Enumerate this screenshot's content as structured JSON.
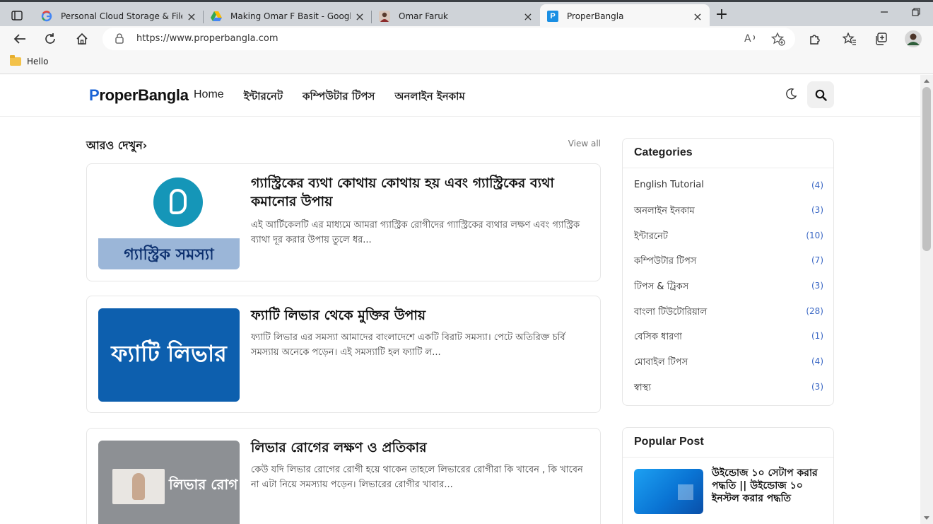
{
  "browser": {
    "tabs": [
      {
        "title": "Personal Cloud Storage & File Sh",
        "favicon": "google-icon"
      },
      {
        "title": "Making Omar F Basit - Google D",
        "favicon": "google-drive-icon"
      },
      {
        "title": "Omar Faruk",
        "favicon": "profile-photo-icon"
      },
      {
        "title": "ProperBangla",
        "favicon": "properbangla-p-icon",
        "favicon_letter": "P"
      }
    ],
    "url": "https://www.properbangla.com",
    "bookmark": "Hello"
  },
  "site": {
    "logo_first": "P",
    "logo_rest": "roperBangla",
    "nav": [
      "Home",
      "ইন্টারনেট",
      "কম্পিউটার টিপস",
      "অনলাইন ইনকাম"
    ]
  },
  "main": {
    "section_title": "আরও দেখুন",
    "view_all": "View all",
    "posts": [
      {
        "title": "গ্যাস্ট্রিকের ব্যথা কোথায় কোথায় হয় এবং গ্যাস্ট্রিকের ব্যথা কমানোর উপায়",
        "excerpt": "এই আর্টিকেলটি এর মাধ্যমে আমরা গ্যাস্ট্রিক রোগীদের  গ্যাস্ট্রিকের ব্যথার লক্ষণ এবং  গ্যাস্ট্রিক ব্যাথা দূর করার উপায় তুলে ধর...",
        "thumb_text": "গ্যাস্ট্রিক সমস্যা"
      },
      {
        "title": "ফ্যাটি লিভার থেকে মুক্তির উপায়",
        "excerpt": "ফ্যাটি লিভার এর সমস্যা আমাদের বাংলাদেশে একটি বিরাট সমস্যা। পেটে অতিরিক্ত চর্বি সমস্যায় অনেকে পড়েন। এই সমস্যাটি হল ফ্যাটি ল...",
        "thumb_text": "ফ্যাটি লিভার"
      },
      {
        "title": "লিভার রোগের লক্ষণ ও প্রতিকার",
        "excerpt": "কেউ যদি লিভার রোগের রোগী হয়ে থাকেন তাহলে লিভারের রোগীরা কি খাবেন , কি খাবেন না এটা নিয়ে সমস্যায় পড়েন।   লিভারের রোগীর খাবার...",
        "thumb_text": "লিভার রোগ"
      }
    ]
  },
  "sidebar": {
    "categories_title": "Categories",
    "categories": [
      {
        "label": "English Tutorial",
        "count": "(4)"
      },
      {
        "label": "অনলাইন ইনকাম",
        "count": "(3)"
      },
      {
        "label": "ইন্টারনেট",
        "count": "(10)"
      },
      {
        "label": "কম্পিউটার টিপস",
        "count": "(7)"
      },
      {
        "label": "টিপস & ট্রিকস",
        "count": "(3)"
      },
      {
        "label": "বাংলা টিউটোরিয়াল",
        "count": "(28)"
      },
      {
        "label": "বেসিক ধারণা",
        "count": "(1)"
      },
      {
        "label": "মোবাইল টিপস",
        "count": "(4)"
      },
      {
        "label": "স্বাস্থ্য",
        "count": "(3)"
      }
    ],
    "popular_title": "Popular Post",
    "popular_post_title": "উইন্ডোজ ১০ সেটাপ করার পদ্ধতি || উইন্ডোজ ১০ ইনস্টল করার পদ্ধতি"
  },
  "colors": {
    "brand_blue": "#1a63d6",
    "count_blue": "#3a67c4"
  }
}
